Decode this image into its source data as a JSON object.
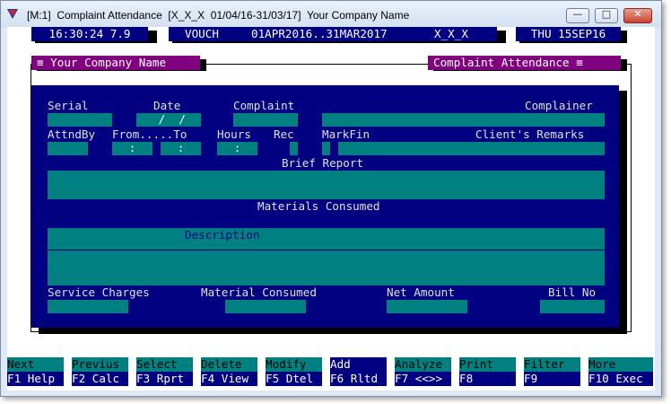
{
  "window": {
    "title": "[M:1]  Complaint Attendance  [X_X_X  01/04/16-31/03/17]  Your Company Name",
    "minimize_glyph": "—",
    "maximize_glyph": "□",
    "close_glyph": "✕"
  },
  "status": {
    "time": "16:30:24 7.9",
    "mode": "VOUCH",
    "period": "01APR2016..31MAR2017",
    "code": "X_X_X",
    "date": "THU 15SEP16"
  },
  "headers": {
    "company": "≡ Your Company Name",
    "module": "Complaint Attendance ≡"
  },
  "form": {
    "labels": {
      "serial": "Serial",
      "date": "Date",
      "complaint": "Complaint",
      "complainer": "Complainer",
      "attnd_by": "AttndBy",
      "from_to": "From.....To",
      "hours": "Hours",
      "rec": "Rec",
      "markfin": "MarkFin",
      "clients_remarks": "Client's Remarks",
      "brief_report": "Brief Report",
      "materials_consumed": "Materials Consumed",
      "description": "Description",
      "service_charges": "Service Charges",
      "material_consumed": "Material Consumed",
      "net_amount": "Net Amount",
      "bill_no": "Bill No"
    },
    "values": {
      "date": " /  /",
      "from_time": ":",
      "to_time": ":",
      "hours": ":"
    }
  },
  "function_keys": [
    {
      "top": "Next",
      "bottom": "F1 Help"
    },
    {
      "top": "Previus",
      "bottom": "F2 Calc"
    },
    {
      "top": "Select",
      "bottom": "F3 Rprt"
    },
    {
      "top": "Delete",
      "bottom": "F4 View"
    },
    {
      "top": "Modify",
      "bottom": "F5 Dtel"
    },
    {
      "top": "Add",
      "bottom": "F6 Rltd"
    },
    {
      "top": "Analyze",
      "bottom": "F7 <<>>"
    },
    {
      "top": "Print",
      "bottom": "F8"
    },
    {
      "top": "Filter",
      "bottom": "F9"
    },
    {
      "top": "More",
      "bottom": "F10 Exec"
    }
  ],
  "colors": {
    "background": "#ffffff",
    "panel": "#000080",
    "field": "#008080",
    "header": "#800080"
  }
}
